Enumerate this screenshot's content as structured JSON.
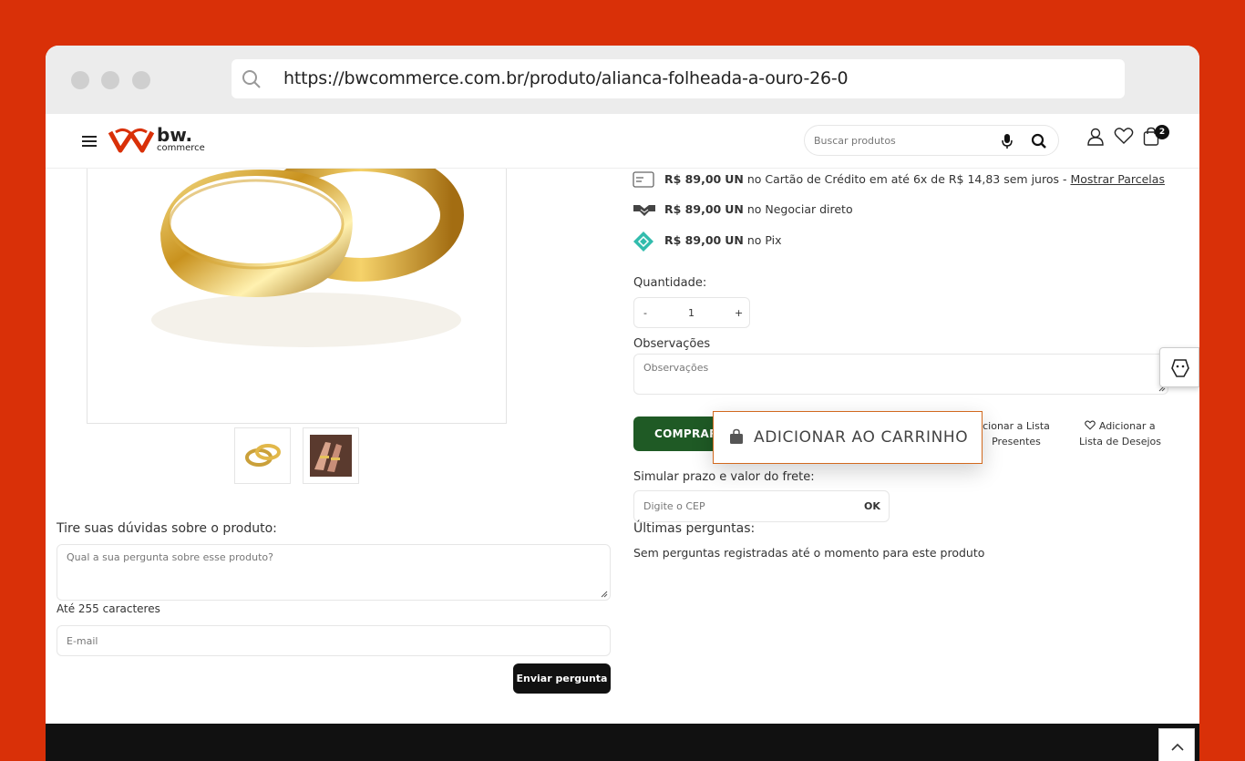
{
  "browser": {
    "url": "https://bwcommerce.com.br/produto/alianca-folheada-a-ouro-26-0"
  },
  "header": {
    "logo_main": "bw.",
    "logo_sub": "commerce",
    "search_placeholder": "Buscar produtos",
    "cart_count": "2"
  },
  "payments": [
    {
      "amount": "R$ 89,00",
      "unit": "UN",
      "text": "no Cartão de Crédito em até 6x de R$ 14,83 sem juros -",
      "link": "Mostrar Parcelas"
    },
    {
      "amount": "R$ 89,00",
      "unit": "UN",
      "text": "no Negociar direto"
    },
    {
      "amount": "R$ 89,00",
      "unit": "UN",
      "text": "no Pix"
    }
  ],
  "purchase": {
    "quantity_label": "Quantidade:",
    "qty_minus": "-",
    "qty_value": "1",
    "qty_plus": "+",
    "observations_label": "Observações",
    "observations_placeholder": "Observações",
    "buy_label": "COMPRAR",
    "popup_text": "ADICIONAR AO CARRINHO",
    "gift_list_label": "cionar a Lista\n Presentes",
    "wishlist_label": "Adicionar a\nLista de Desejos"
  },
  "shipping": {
    "label": "Simular prazo e valor do frete:",
    "placeholder": "Digite o CEP",
    "ok_label": "OK"
  },
  "questions": {
    "title": "Tire suas dúvidas sobre o produto:",
    "question_placeholder": "Qual a sua pergunta sobre esse produto?",
    "char_limit": "Até 255 caracteres",
    "email_placeholder": "E-mail",
    "send_label": "Enviar pergunta",
    "latest_title": "Últimas perguntas:",
    "latest_empty": "Sem perguntas registradas até o momento para este produto"
  },
  "colors": {
    "background": "#d93008",
    "buy_button": "#1f5a25",
    "popup_border": "#d2691e",
    "footer": "#111111"
  }
}
